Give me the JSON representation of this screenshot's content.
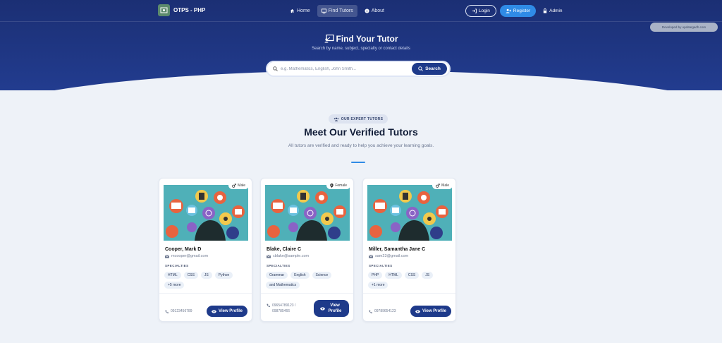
{
  "nav": {
    "brand": "OTPS - PHP",
    "links": [
      {
        "label": "Home",
        "icon": "home-icon",
        "active": false
      },
      {
        "label": "Find Tutors",
        "icon": "chalkboard-icon",
        "active": true
      },
      {
        "label": "About",
        "icon": "info-icon",
        "active": false
      }
    ],
    "login": "Login",
    "register": "Register",
    "admin": "Admin"
  },
  "dev_badge": "Developed by updategadh.com",
  "hero": {
    "title": "Find Your Tutor",
    "subtitle": "Search by name, subject, specialty or contact details",
    "search_placeholder": "e.g. Mathematics, English, John Smith...",
    "search_button": "Search"
  },
  "section": {
    "pill": "OUR EXPERT TUTORS",
    "title": "Meet Our Verified Tutors",
    "description": "All tutors are verified and ready to help you achieve your learning goals."
  },
  "specialties_label": "SPECIALTIES",
  "view_profile": "View Profile",
  "tutors": [
    {
      "name": "Cooper, Mark D",
      "email": "mcooper@gmail.com",
      "gender": "Male",
      "tags": [
        "HTML",
        "CSS",
        "JS",
        "Python",
        "+5 more"
      ],
      "phone": "09123456789"
    },
    {
      "name": "Blake, Claire C",
      "email": "cblake@sample.com",
      "gender": "Female",
      "tags": [
        "Grammar",
        "English",
        "Science",
        "and Mathematics"
      ],
      "phone": "09654789123 / 098785466"
    },
    {
      "name": "Miller, Samantha Jane C",
      "email": "sam23@gmail.com",
      "gender": "Male",
      "tags": [
        "PHP",
        "HTML",
        "CSS",
        "JS",
        "+1 more"
      ],
      "phone": "09789654123"
    }
  ],
  "colors": {
    "primary": "#1e3a8a",
    "accent": "#2f8be6",
    "hero_bg": "#1b2f74",
    "page_bg": "#eef2f8"
  }
}
